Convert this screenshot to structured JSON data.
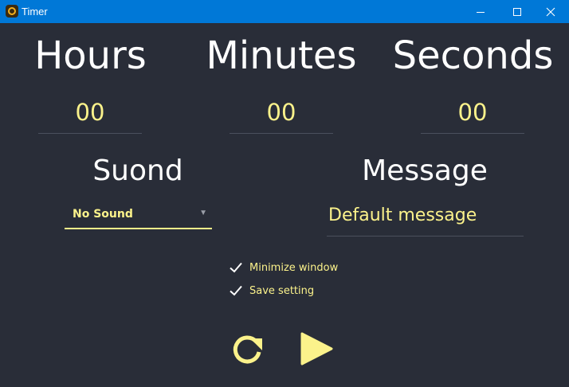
{
  "window": {
    "title": "Timer",
    "controls": {
      "minimize_icon": "minimize-icon",
      "maximize_icon": "maximize-icon",
      "close_icon": "close-icon"
    }
  },
  "time": {
    "hours_label": "Hours",
    "minutes_label": "Minutes",
    "seconds_label": "Seconds",
    "hours_value": "00",
    "minutes_value": "00",
    "seconds_value": "00"
  },
  "sound": {
    "label": "Suond",
    "selected": "No Sound"
  },
  "message": {
    "label": "Message",
    "value": "Default message"
  },
  "options": [
    {
      "label": "Minimize window",
      "checked": true
    },
    {
      "label": "Save setting",
      "checked": true
    }
  ],
  "actions": {
    "reset_icon": "refresh-icon",
    "start_icon": "play-icon"
  },
  "colors": {
    "background": "#292d38",
    "accent": "#fbf28b",
    "titlebar": "#0078d7",
    "text": "#ffffff"
  }
}
